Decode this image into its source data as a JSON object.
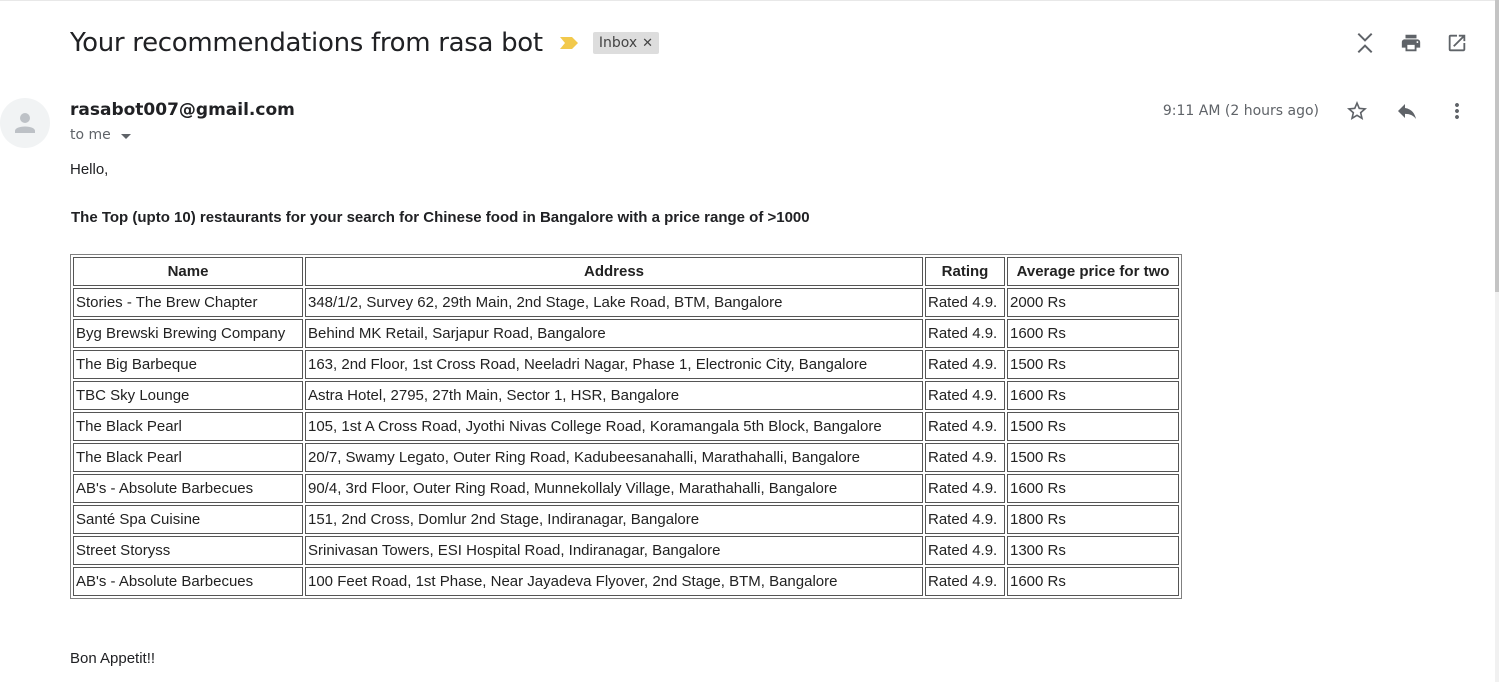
{
  "email": {
    "subject": "Your recommendations from rasa bot",
    "label": "Inbox",
    "sender": "rasabot007@gmail.com",
    "recipient": "to me",
    "timestamp": "9:11 AM (2 hours ago)",
    "greeting": "Hello,",
    "headline": "The Top (upto 10) restaurants for your search for Chinese food in Bangalore with a price range of >1000",
    "signoff": "Bon Appetit!!"
  },
  "icons": {
    "importance": "importance-marker-icon",
    "label_remove": "close-icon",
    "collapse": "collapse-all-icon",
    "print": "print-icon",
    "popout": "open-in-new-window-icon",
    "star": "star-icon",
    "reply": "reply-icon",
    "more": "more-vertical-icon",
    "avatar": "default-avatar-icon"
  },
  "colors": {
    "importance": "#f2c94c",
    "icon": "#5f6368",
    "label_bg": "#dddddd"
  },
  "table": {
    "headers": [
      "Name",
      "Address",
      "Rating",
      "Average price for two"
    ],
    "rows": [
      [
        "Stories - The Brew Chapter",
        "348/1/2, Survey 62, 29th Main, 2nd Stage, Lake Road, BTM, Bangalore",
        "Rated 4.9.",
        "2000 Rs"
      ],
      [
        "Byg Brewski Brewing Company",
        "Behind MK Retail, Sarjapur Road, Bangalore",
        "Rated 4.9.",
        "1600 Rs"
      ],
      [
        "The Big Barbeque",
        "163, 2nd Floor, 1st Cross Road, Neeladri Nagar, Phase 1, Electronic City, Bangalore",
        "Rated 4.9.",
        "1500 Rs"
      ],
      [
        "TBC Sky Lounge",
        "Astra Hotel, 2795, 27th Main, Sector 1, HSR, Bangalore",
        "Rated 4.9.",
        "1600 Rs"
      ],
      [
        "The Black Pearl",
        "105, 1st A Cross Road, Jyothi Nivas College Road, Koramangala 5th Block, Bangalore",
        "Rated 4.9.",
        "1500 Rs"
      ],
      [
        "The Black Pearl",
        "20/7, Swamy Legato, Outer Ring Road, Kadubeesanahalli, Marathahalli, Bangalore",
        "Rated 4.9.",
        "1500 Rs"
      ],
      [
        "AB's - Absolute Barbecues",
        "90/4, 3rd Floor, Outer Ring Road, Munnekollaly Village, Marathahalli, Bangalore",
        "Rated 4.9.",
        "1600 Rs"
      ],
      [
        "Santé Spa Cuisine",
        "151, 2nd Cross, Domlur 2nd Stage, Indiranagar, Bangalore",
        "Rated 4.9.",
        "1800 Rs"
      ],
      [
        "Street Storyss",
        "Srinivasan Towers, ESI Hospital Road, Indiranagar, Bangalore",
        "Rated 4.9.",
        "1300 Rs"
      ],
      [
        "AB's - Absolute Barbecues",
        "100 Feet Road, 1st Phase, Near Jayadeva Flyover, 2nd Stage, BTM, Bangalore",
        "Rated 4.9.",
        "1600 Rs"
      ]
    ]
  }
}
